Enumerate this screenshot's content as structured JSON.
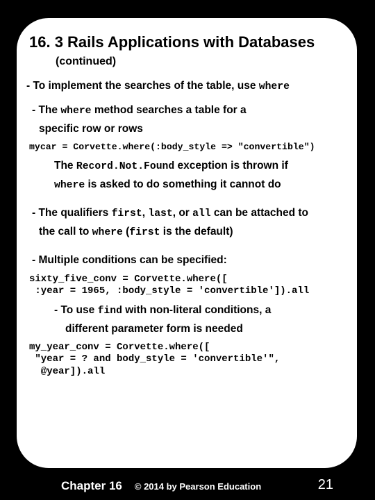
{
  "title": "16. 3 Rails Applications with Databases",
  "continued": "(continued)",
  "p1_a": "- To implement the searches of the table, use ",
  "p1_code": "where",
  "p2_a": "- The ",
  "p2_code": "where",
  "p2_b": " method searches a table for a",
  "p2_c": "specific row or rows",
  "code1": "mycar = Corvette.where(:body_style => \"convertible\")",
  "p3_a": "The ",
  "p3_code1": "Record.Not.Found",
  "p3_b": " exception is thrown if",
  "p3_code2": "where",
  "p3_c": " is asked to do something it cannot do",
  "p4_a": "- The qualifiers ",
  "p4_c1": "first",
  "p4_s1": ", ",
  "p4_c2": "last",
  "p4_s2": ", or ",
  "p4_c3": "all",
  "p4_b": " can be attached to",
  "p4_d": "the call to ",
  "p4_c4": "where",
  "p4_s3": " (",
  "p4_c5": "first",
  "p4_e": " is the default)",
  "p5": "- Multiple conditions can be specified:",
  "code2": "sixty_five_conv = Corvette.where([\n :year = 1965, :body_style = 'convertible']).all",
  "p6_a": "- To use ",
  "p6_code": "find",
  "p6_b": " with non-literal conditions, a",
  "p6_c": "different parameter form is needed",
  "code3": "my_year_conv = Corvette.where([\n \"year = ? and body_style = 'convertible'\",\n  @year]).all",
  "footer": {
    "chapter": "Chapter 16",
    "copy": "© 2014 by Pearson Education",
    "page": "21"
  }
}
